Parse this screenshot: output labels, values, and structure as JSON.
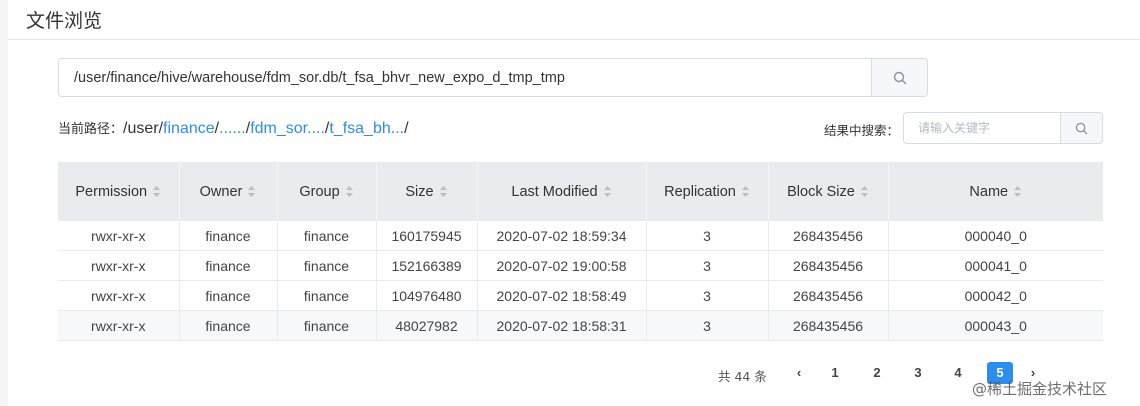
{
  "page": {
    "title": "文件浏览"
  },
  "search": {
    "value": "/user/finance/hive/warehouse/fdm_sor.db/t_fsa_bhvr_new_expo_d_tmp_tmp",
    "button_icon": "search-icon"
  },
  "path": {
    "label": "当前路径：",
    "root": "/user/",
    "segments": [
      "finance",
      "......",
      "fdm_sor....",
      "t_fsa_bh..."
    ],
    "separator": "/"
  },
  "filter": {
    "label": "结果中搜索：",
    "placeholder": "请输入关键字",
    "button_icon": "search-icon"
  },
  "table": {
    "columns": [
      "Permission",
      "Owner",
      "Group",
      "Size",
      "Last Modified",
      "Replication",
      "Block Size",
      "Name"
    ],
    "rows": [
      {
        "permission": "rwxr-xr-x",
        "owner": "finance",
        "group": "finance",
        "size": "160175945",
        "modified": "2020-07-02 18:59:34",
        "replication": "3",
        "block_size": "268435456",
        "name": "000040_0"
      },
      {
        "permission": "rwxr-xr-x",
        "owner": "finance",
        "group": "finance",
        "size": "152166389",
        "modified": "2020-07-02 19:00:58",
        "replication": "3",
        "block_size": "268435456",
        "name": "000041_0"
      },
      {
        "permission": "rwxr-xr-x",
        "owner": "finance",
        "group": "finance",
        "size": "104976480",
        "modified": "2020-07-02 18:58:49",
        "replication": "3",
        "block_size": "268435456",
        "name": "000042_0"
      },
      {
        "permission": "rwxr-xr-x",
        "owner": "finance",
        "group": "finance",
        "size": "48027982",
        "modified": "2020-07-02 18:58:31",
        "replication": "3",
        "block_size": "268435456",
        "name": "000043_0"
      }
    ]
  },
  "pagination": {
    "total": "共 44 条",
    "prev": "‹",
    "pages": [
      "1",
      "2",
      "3",
      "4",
      "5"
    ],
    "current": "5",
    "next": "›"
  },
  "watermark": "@稀土掘金技术社区",
  "colors": {
    "accent": "#2d8cf0",
    "header_bg": "#e9ebee"
  }
}
